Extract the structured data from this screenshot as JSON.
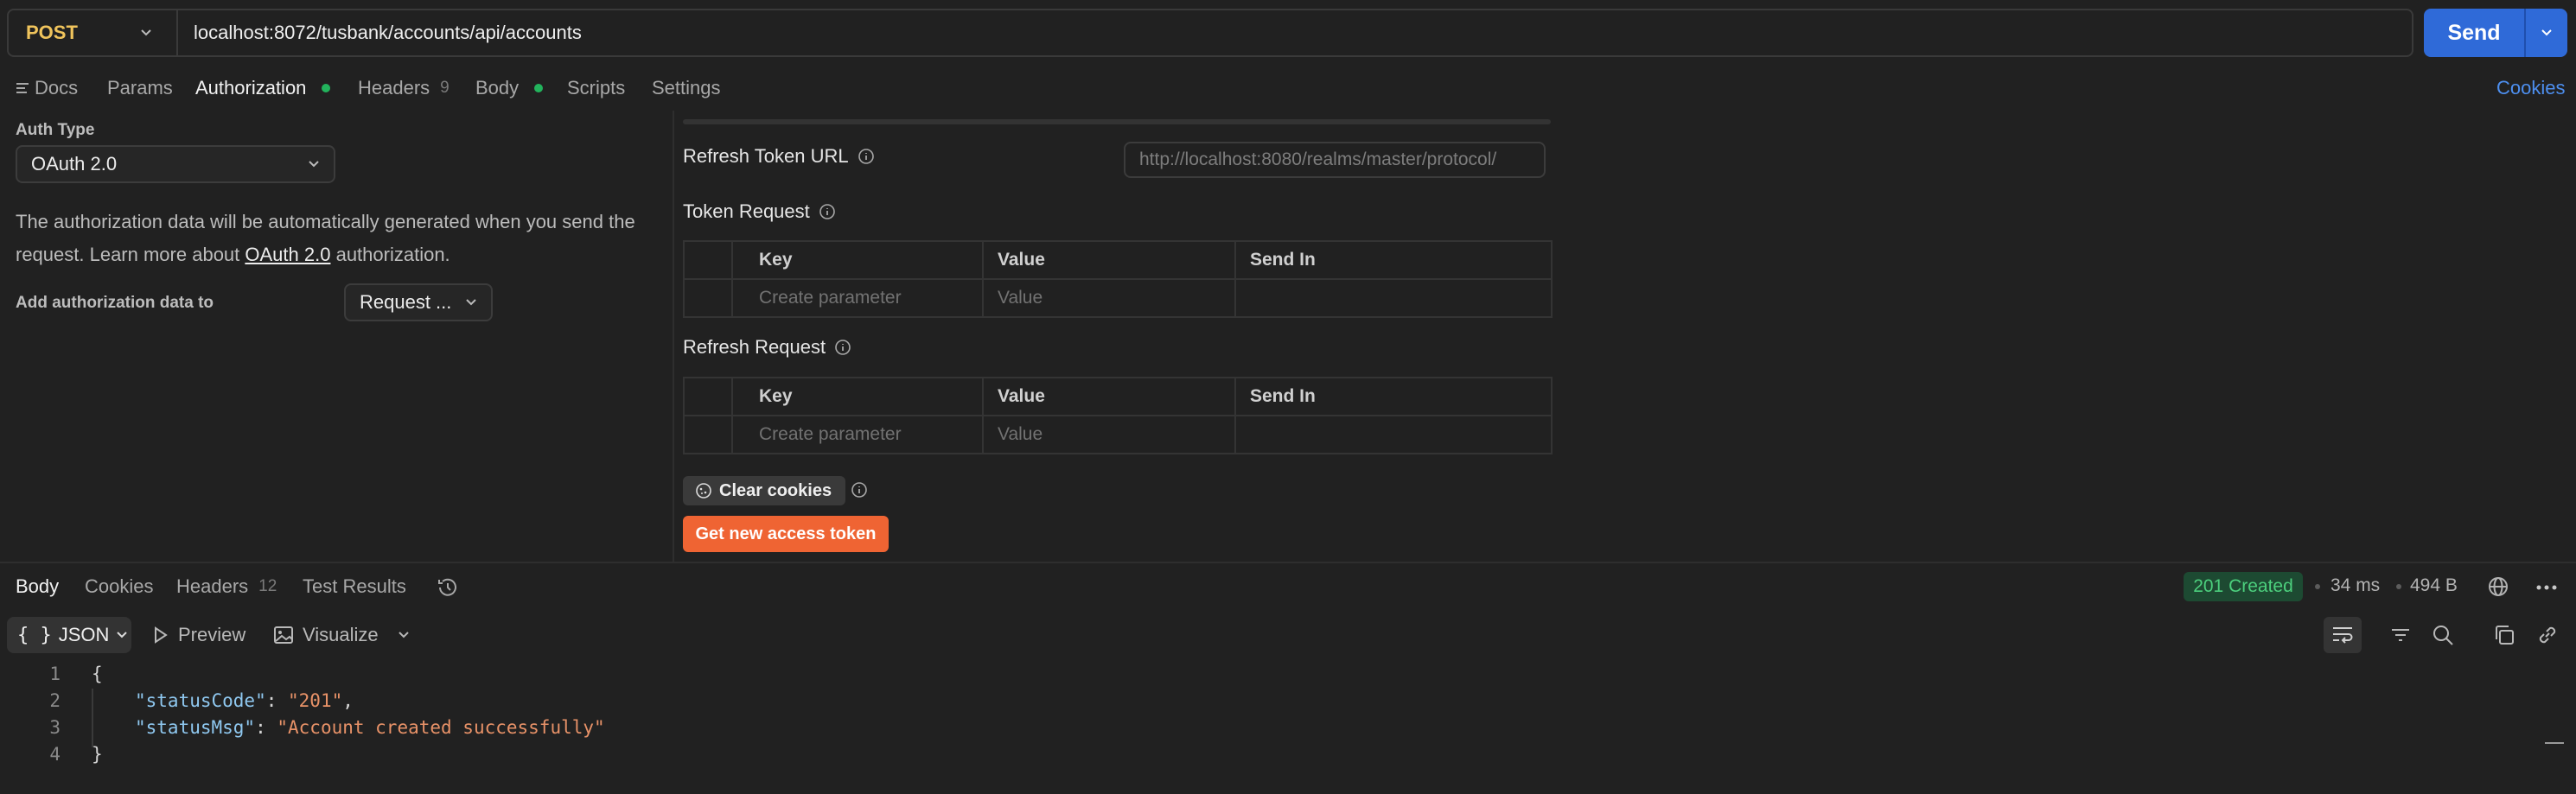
{
  "request": {
    "method": "POST",
    "url": "localhost:8072/tusbank/accounts/api/accounts",
    "send_label": "Send"
  },
  "request_tabs": {
    "docs": "Docs",
    "params": "Params",
    "authorization": "Authorization",
    "headers": "Headers",
    "headers_count": "9",
    "body": "Body",
    "scripts": "Scripts",
    "settings": "Settings",
    "cookies": "Cookies"
  },
  "auth": {
    "auth_type_label": "Auth Type",
    "auth_type_value": "OAuth 2.0",
    "description_before": "The authorization data will be automatically generated when you send the request. Learn more about ",
    "description_link": "OAuth 2.0",
    "description_after": " authorization.",
    "add_to_label": "Add authorization data to",
    "add_to_value": "Request ..."
  },
  "config": {
    "refresh_token_url_label": "Refresh Token URL",
    "refresh_token_url_placeholder": "http://localhost:8080/realms/master/protocol/",
    "token_request_label": "Token Request",
    "refresh_request_label": "Refresh Request",
    "columns": [
      "Key",
      "Value",
      "Send In"
    ],
    "key_placeholder": "Create parameter",
    "value_placeholder": "Value",
    "clear_cookies": "Clear cookies",
    "get_token": "Get new access token"
  },
  "response_tabs": {
    "body": "Body",
    "cookies": "Cookies",
    "headers": "Headers",
    "headers_count": "12",
    "test_results": "Test Results"
  },
  "response_meta": {
    "status": "201 Created",
    "time": "34 ms",
    "size": "494 B"
  },
  "viewer": {
    "format": "JSON",
    "preview": "Preview",
    "visualize": "Visualize"
  },
  "code": {
    "line_numbers": [
      "1",
      "2",
      "3",
      "4"
    ],
    "open_brace": "{",
    "close_brace": "}",
    "key1": "\"statusCode\"",
    "val1": "\"201\"",
    "key2": "\"statusMsg\"",
    "val2": "\"Account created successfully\""
  },
  "colors": {
    "accent": "#2f6ad8",
    "token_button": "#ef6433",
    "status_ok": "#4ccf7d",
    "method": "#f0c45c"
  }
}
